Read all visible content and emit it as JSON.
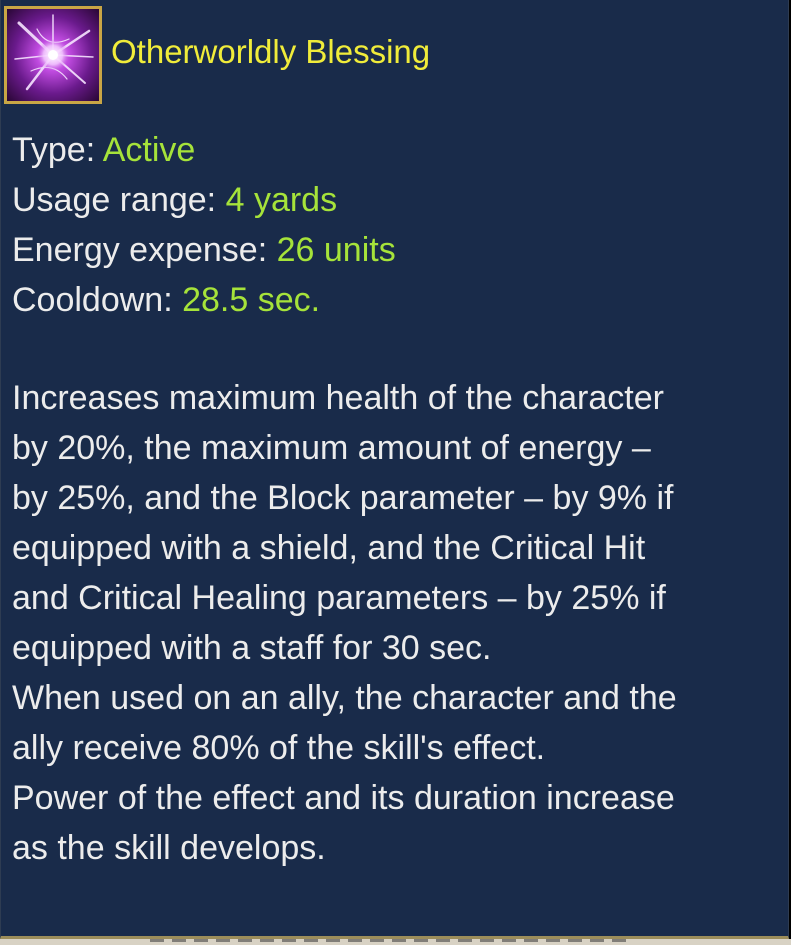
{
  "skill": {
    "name": "Otherworldly Blessing",
    "icon": "purple-burst-skill-icon"
  },
  "stats": [
    {
      "label": "Type:",
      "value": "Active"
    },
    {
      "label": "Usage range:",
      "value": "4 yards"
    },
    {
      "label": "Energy expense:",
      "value": "26 units"
    },
    {
      "label": "Cooldown:",
      "value": "28.5 sec."
    }
  ],
  "description_lines": [
    "Increases maximum health of the character",
    "by 20%, the maximum amount of energy –",
    "by 25%, and the Block parameter – by 9% if",
    "equipped with a shield, and the Critical Hit",
    "and Critical Healing parameters – by 25% if",
    "equipped with a staff for 30 sec.",
    "When used on an ally, the character and the",
    "ally receive 80% of the skill's effect.",
    "Power of the effect and its duration increase",
    "as the skill develops."
  ],
  "colors": {
    "background": "#192b4a",
    "title": "#f0ec3a",
    "value": "#a6e33a",
    "text": "#ececec",
    "icon_border": "#c9a645"
  }
}
